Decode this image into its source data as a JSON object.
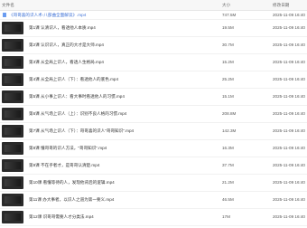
{
  "header": {
    "name": "文件名",
    "size": "大小",
    "modified": "修改日期"
  },
  "files": [
    {
      "name": "《哥哥喜的识人术-八部曲全面解读》.mp4",
      "size": "747.5M",
      "date": "2025-11-09 16:40"
    },
    {
      "name": "第1课 认清识人，看透他人本质.mp4",
      "size": "19.5M",
      "date": "2025-11-09 16:40"
    },
    {
      "name": "第2课 认识识人，真正的大才是大师.mp4",
      "size": "30.7M",
      "date": "2025-11-09 16:40"
    },
    {
      "name": "第3课 从全局上识人，看透人生格局.mp4",
      "size": "15.2M",
      "date": "2025-11-09 16:40"
    },
    {
      "name": "第4课 从全局上识人（下）：看透他人的底色.mp4",
      "size": "25.2M",
      "date": "2025-11-09 16:40"
    },
    {
      "name": "第5课 从小事上识人：看大事时看透他人的习惯.mp4",
      "size": "15.1M",
      "date": "2025-11-09 16:40"
    },
    {
      "name": "第6课 从气场上识人（上）：识别不良人格的习惯.mp4",
      "size": "208.8M",
      "date": "2025-11-09 16:40"
    },
    {
      "name": "第7课 从气场上识人（下）：哥哥喜的识人\"哥哥知识\".mp4",
      "size": "142.3M",
      "date": "2025-11-09 16:40"
    },
    {
      "name": "第8课 懂哥哥的识人方法，\"哥哥知识\".mp4",
      "size": "16.3M",
      "date": "2025-11-09 16:40"
    },
    {
      "name": "第9课 不在乎者才，是哥哥认清楚.mp4",
      "size": "37.7M",
      "date": "2025-11-09 16:40"
    },
    {
      "name": "第10课 看懂等待的人，发现他背后的逻辑.mp4",
      "size": "21.2M",
      "date": "2025-11-09 16:40"
    },
    {
      "name": "第11课 办大事者，以识人之道为第一要义.mp4",
      "size": "46.5M",
      "date": "2025-11-09 16:40"
    },
    {
      "name": "第12课 识哥哥需要人才分类法.mp4",
      "size": "17M",
      "date": "2025-11-09 16:40"
    }
  ]
}
